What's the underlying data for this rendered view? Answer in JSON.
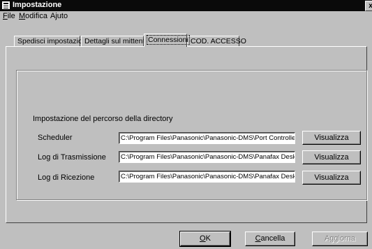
{
  "window": {
    "title": "Impostazione",
    "close_glyph": "x"
  },
  "menu": [
    {
      "label": "File",
      "accel": "F",
      "rest": "ile"
    },
    {
      "label": "Modifica",
      "accel": "M",
      "rest": "odifica"
    },
    {
      "label": "Ajuto",
      "accel": "",
      "rest": "Ajuto"
    }
  ],
  "tabs": [
    {
      "label": "Spedisci impostazioni",
      "active": false
    },
    {
      "label": "Dettagli sul mittente",
      "active": false
    },
    {
      "label": "Connessioni",
      "active": true
    },
    {
      "label": "COD. ACCESSO",
      "active": false
    }
  ],
  "group": {
    "heading": "Impostazione del percorso della directory",
    "rows": [
      {
        "label": "Scheduler",
        "value": "C:\\Program Files\\Panasonic\\Panasonic-DMS\\Port Controller",
        "button": "Visualizza"
      },
      {
        "label": "Log di Trasmissione",
        "value": "C:\\Program Files\\Panasonic\\Panasonic-DMS\\Panafax Desk",
        "button": "Visualizza"
      },
      {
        "label": "Log di Ricezione",
        "value": "C:\\Program Files\\Panasonic\\Panasonic-DMS\\Panafax Desk",
        "button": "Visualizza"
      }
    ]
  },
  "buttons": {
    "ok": {
      "accel": "O",
      "rest": "K"
    },
    "cancel": {
      "accel": "C",
      "rest": "ancella"
    },
    "update": {
      "label": "Aggiorna",
      "disabled": true
    }
  }
}
